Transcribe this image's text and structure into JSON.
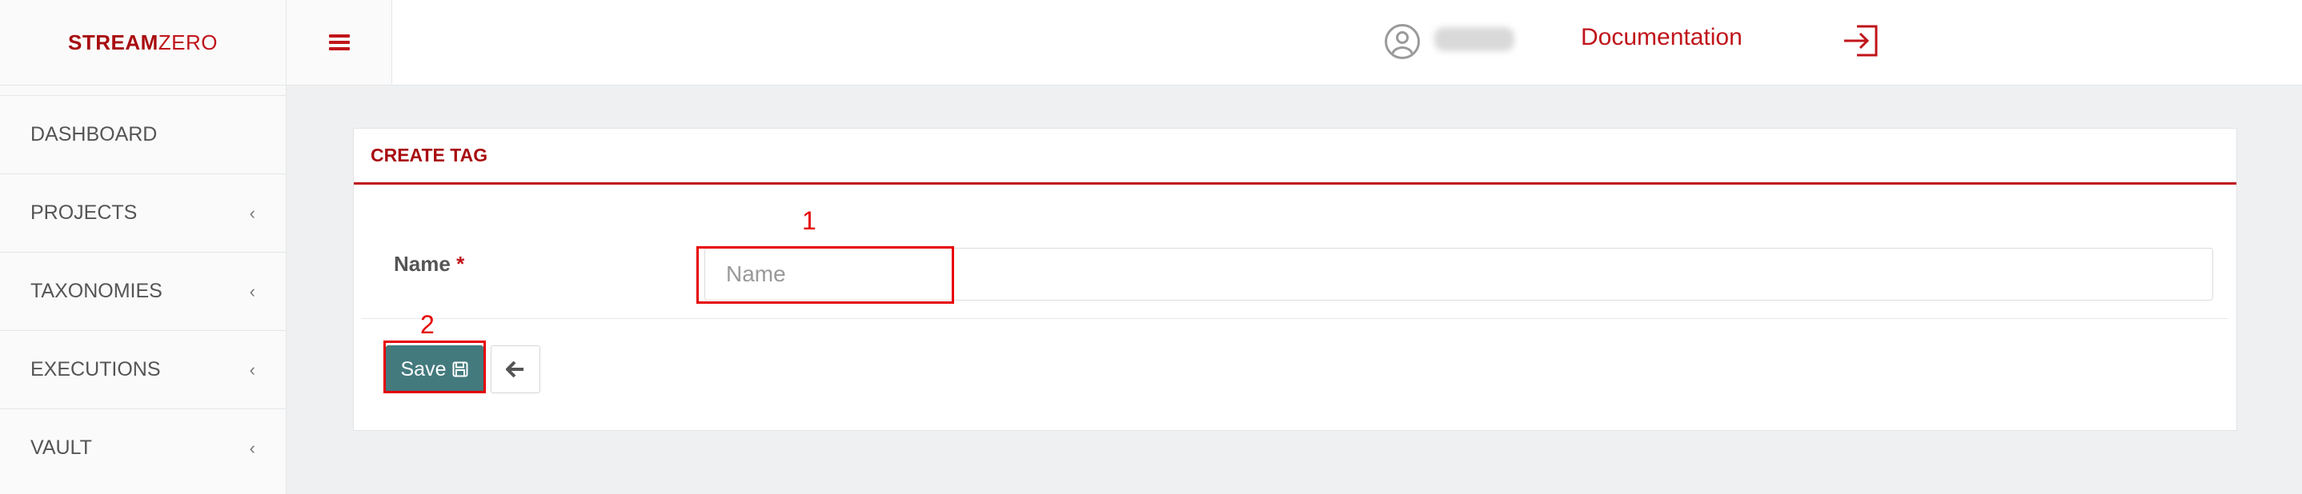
{
  "brand": {
    "bold": "STREAM",
    "light": "ZERO"
  },
  "header": {
    "documentation_label": "Documentation",
    "menu_icon": "hamburger-icon",
    "user_icon": "user-circle-icon",
    "logout_icon": "sign-out-icon"
  },
  "sidebar": {
    "items": [
      {
        "label": "DASHBOARD",
        "chevron": ""
      },
      {
        "label": "PROJECTS",
        "chevron": "‹"
      },
      {
        "label": "TAXONOMIES",
        "chevron": "‹"
      },
      {
        "label": "EXECUTIONS",
        "chevron": "‹"
      },
      {
        "label": "VAULT",
        "chevron": "‹"
      }
    ]
  },
  "form": {
    "title": "CREATE TAG",
    "name_label": "Name",
    "required_mark": "*",
    "name_placeholder": "Name",
    "name_value": "",
    "save_label": "Save",
    "save_icon": "floppy-disk-icon",
    "back_icon": "arrow-left-icon"
  },
  "annotations": {
    "first": "1",
    "second": "2"
  },
  "colors": {
    "accent": "#c0141a",
    "save_button": "#437a7e",
    "annotation": "#e60000"
  }
}
